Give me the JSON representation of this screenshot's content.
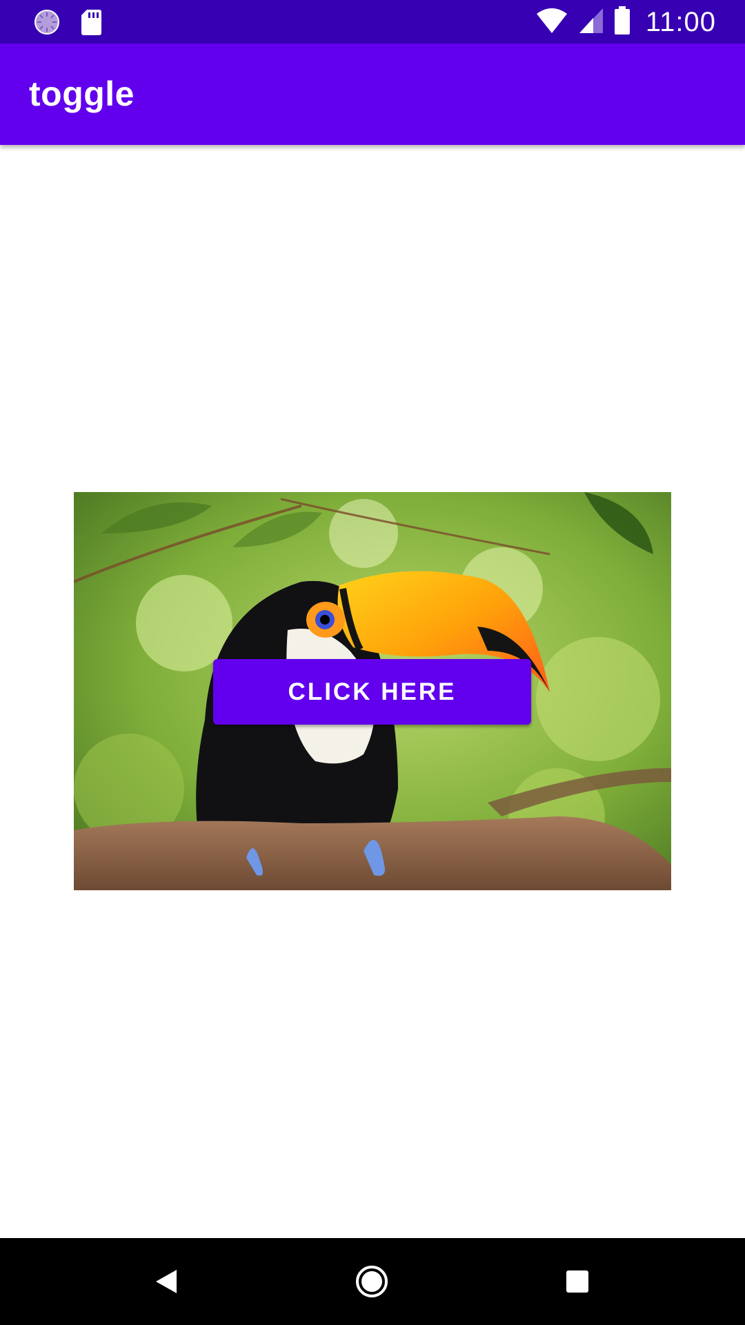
{
  "status_bar": {
    "time": "11:00",
    "left_icons": [
      "sync-icon",
      "sd-card-icon"
    ],
    "right_icons": [
      "wifi-icon",
      "cell-signal-icon",
      "battery-icon"
    ],
    "background": "#3700b3"
  },
  "app_bar": {
    "title": "toggle",
    "background": "#6200ee"
  },
  "main": {
    "image_subject": "toucan on branch",
    "button_label": "CLICK HERE",
    "button_color": "#6200ee"
  },
  "nav_bar": {
    "buttons": [
      "back-icon",
      "home-icon",
      "recents-icon"
    ]
  }
}
